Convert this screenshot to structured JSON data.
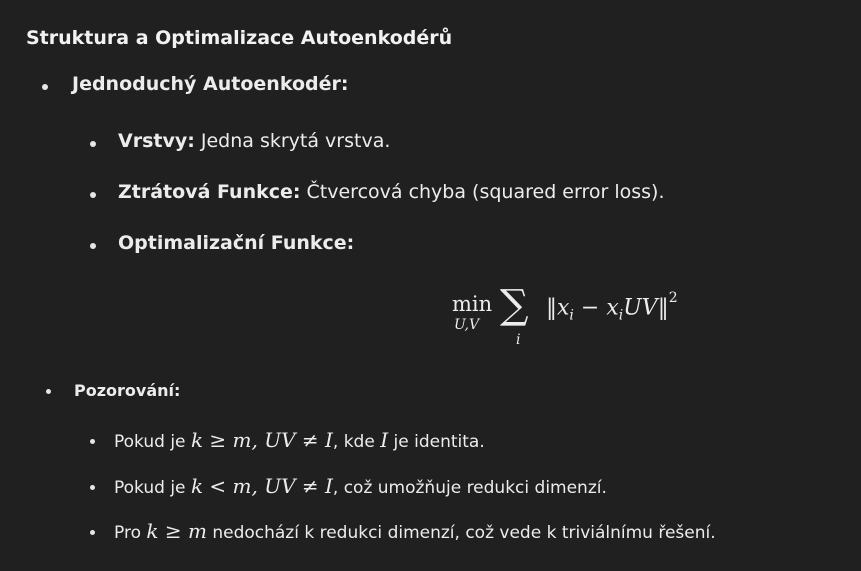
{
  "title": "Struktura a Optimalizace Autoenkodérů",
  "simple": {
    "heading": "Jednoduchý Autoenkodér:",
    "layers_label": "Vrstvy:",
    "layers_text": "Jedna skrytá vrstva.",
    "loss_label": "Ztrátová Funkce:",
    "loss_text": "Čtvercová chyba (squared error loss).",
    "opt_label": "Optimalizační Funkce:",
    "formula": {
      "min": "min",
      "min_sub": "U,V",
      "sum": "∑",
      "sum_sub": "i",
      "norm_open": "‖",
      "x": "x",
      "i": "i",
      "minus": "−",
      "uv": "UV",
      "norm_close": "‖",
      "sq": "2"
    }
  },
  "observations": {
    "heading": "Pozorování:",
    "items": [
      {
        "pre": "Pokud je ",
        "math": "k ≥ m, UV ≠ I",
        "mid": ", kde ",
        "math2": "I",
        "post": " je identita."
      },
      {
        "pre": "Pokud je ",
        "math": "k < m, UV ≠ I",
        "post": ", což umožňuje redukci dimenzí."
      },
      {
        "pre": "Pro ",
        "math": "k ≥ m",
        "post": " nedochází k redukci dimenzí, což vede k triviálnímu řešení."
      }
    ]
  }
}
